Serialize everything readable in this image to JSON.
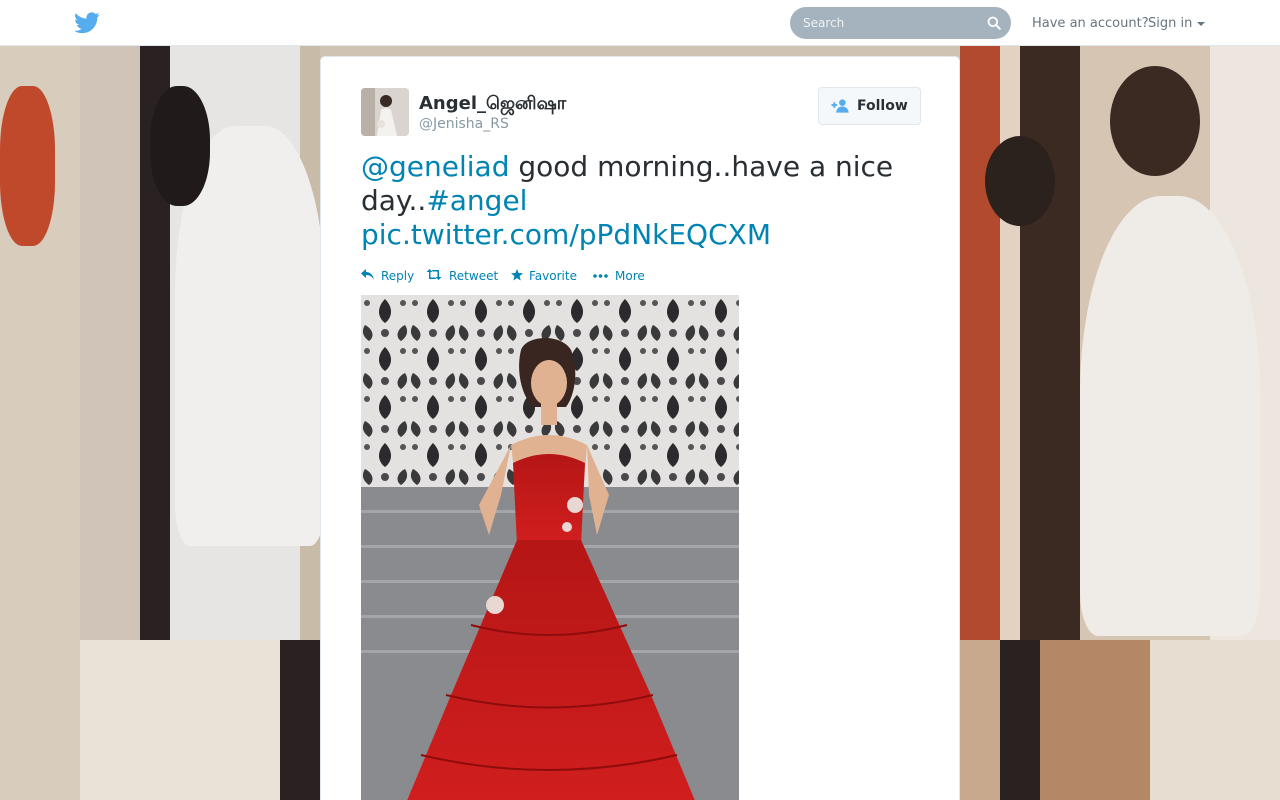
{
  "topbar": {
    "logo_icon": "twitter-bird-icon",
    "search_placeholder": "Search",
    "have_account": "Have an account?",
    "signin_label": "Sign in"
  },
  "tweet": {
    "display_name": "Angel_ஜெனிஷா",
    "screen_name": "@Jenisha_RS",
    "follow_label": "Follow",
    "text": {
      "mention": "@geneliad",
      "body": " good morning..have a nice day..",
      "hashtag": "#angel",
      "link": "pic.twitter.com/pPdNkEQCXM"
    },
    "actions": {
      "reply": "Reply",
      "retweet": "Retweet",
      "favorite": "Favorite",
      "more": "More"
    }
  },
  "colors": {
    "link": "#0084b4",
    "text": "#292f33",
    "muted": "#8899a6",
    "twitter_blue": "#55acee"
  }
}
